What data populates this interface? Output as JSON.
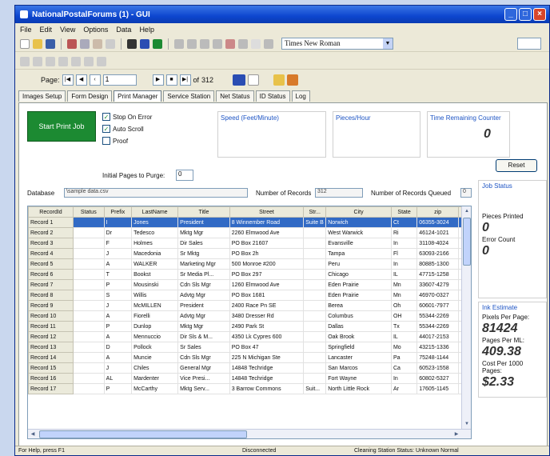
{
  "window": {
    "title": "NationalPostalForums (1) - GUI"
  },
  "menu": [
    "File",
    "Edit",
    "View",
    "Options",
    "Data",
    "Help"
  ],
  "toolbar": {
    "font": "Times New Roman"
  },
  "pager": {
    "label": "Page:",
    "current": "1",
    "of": "of",
    "total": "312"
  },
  "tabs": [
    "Images Setup",
    "Form Design",
    "Print Manager",
    "Service Station",
    "Net Status",
    "ID Status",
    "Log"
  ],
  "print": {
    "start_label": "Start Print Job",
    "checkboxes": [
      {
        "label": "Stop On Error",
        "checked": true
      },
      {
        "label": "Auto Scroll",
        "checked": true
      },
      {
        "label": "Proof",
        "checked": false
      }
    ],
    "speed_label": "Speed (Feet/Minute)",
    "pieces_label": "Pieces/Hour",
    "time_label": "Time Remaining Counter",
    "time_value": "0",
    "reset_label": "Reset",
    "initial_pages_label": "Initial Pages to Purge:",
    "initial_pages_value": "0",
    "database_label": "Database",
    "database_value": "\\sample data.csv",
    "num_records_label": "Number of Records",
    "num_records_value": "312",
    "queued_label": "Number of Records Queued",
    "queued_value": "0"
  },
  "grid": {
    "columns": [
      "RecordId",
      "Status",
      "Prefix",
      "LastName",
      "Title",
      "Street",
      "Str...",
      "City",
      "State",
      "zip"
    ],
    "rows": [
      [
        "Record 1",
        "",
        "I",
        "Jones",
        "President",
        "8 Winnember Road",
        "Suite B",
        "Norwich",
        "Ct",
        "06355-3024"
      ],
      [
        "Record 2",
        "",
        "Dr",
        "Tedesco",
        "Mktg Mgr",
        "2260 Elmwood Ave",
        "",
        "West Warwick",
        "Ri",
        "46124-1021"
      ],
      [
        "Record 3",
        "",
        "F",
        "Holmes",
        "Dir Sales",
        "PO Box 21607",
        "",
        "Evansville",
        "In",
        "31108-4024"
      ],
      [
        "Record 4",
        "",
        "J",
        "Macedonia",
        "Sr Mktg",
        "PO Box 2h",
        "",
        "Tampa",
        "Fl",
        "63093-2166"
      ],
      [
        "Record 5",
        "",
        "A",
        "WALKER",
        "Marketing Mgr",
        "500 Monroe #200",
        "",
        "Peru",
        "In",
        "80885-1300"
      ],
      [
        "Record 6",
        "",
        "T",
        "Bookst",
        "Sr Media Pl...",
        "PO Box 297",
        "",
        "Chicago",
        "IL",
        "47715-1258"
      ],
      [
        "Record 7",
        "",
        "P",
        "Mousinski",
        "Cdn Sls Mgr",
        "1260 Elmwood Ave",
        "",
        "Eden Prairie",
        "Mn",
        "33607-4279"
      ],
      [
        "Record 8",
        "",
        "S",
        "Willis",
        "Advtg Mgr",
        "PO Box 1681",
        "",
        "Eden Prairie",
        "Mn",
        "46970-0327"
      ],
      [
        "Record 9",
        "",
        "J",
        "McMILLEN",
        "President",
        "2400 Race Pn SE",
        "",
        "Berea",
        "Oh",
        "60601-7977"
      ],
      [
        "Record 10",
        "",
        "A",
        "Fiorelli",
        "Advtg Mgr",
        "3480 Dresser Rd",
        "",
        "Columbus",
        "OH",
        "55344-2269"
      ],
      [
        "Record 11",
        "",
        "P",
        "Dunlop",
        "Mktg Mgr",
        "2490 Park St",
        "",
        "Dallas",
        "Tx",
        "55344-2269"
      ],
      [
        "Record 12",
        "",
        "A",
        "Mennuccio",
        "Dir Sls & M...",
        "4350 Lk Cypres 600",
        "",
        "Oak Brook",
        "IL",
        "44017-2153"
      ],
      [
        "Record 13",
        "",
        "D",
        "Pollock",
        "Sr Sales",
        "PO Box 47",
        "",
        "Springfield",
        "Mo",
        "43215-1336"
      ],
      [
        "Record 14",
        "",
        "A",
        "Muncie",
        "Cdn Sls Mgr",
        "225 N Michigan Ste",
        "",
        "Lancaster",
        "Pa",
        "75248-1144"
      ],
      [
        "Record 15",
        "",
        "J",
        "Chiles",
        "General Mgr",
        "14848 Techridge",
        "",
        "San Marcos",
        "Ca",
        "60523-1558"
      ],
      [
        "Record 16",
        "",
        "AL",
        "Mardenter",
        "Vice Presi...",
        "14848 Techridge",
        "",
        "Fort Wayne",
        "In",
        "60802-5327"
      ],
      [
        "Record 17",
        "",
        "P",
        "McCarthy",
        "Mktg Serv...",
        "3 Barrow Commons",
        "Suit...",
        "North Little Rock",
        "Ar",
        "17605-1145"
      ]
    ]
  },
  "side": {
    "job_status_label": "Job Status",
    "pieces_printed_label": "Pieces Printed",
    "pieces_printed_value": "0",
    "error_count_label": "Error Count",
    "error_count_value": "0",
    "ink_label": "Ink Estimate",
    "pixels_label": "Pixels Per Page:",
    "pixels_value": "81424",
    "pages_label": "Pages Per ML:",
    "pages_value": "409.38",
    "cost_label": "Cost Per 1000 Pages:",
    "cost_value": "$2.33"
  },
  "status": {
    "left": "For Help, press F1",
    "middle": "Disconnected",
    "right": "Cleaning Station Status: Unknown   Normal"
  }
}
